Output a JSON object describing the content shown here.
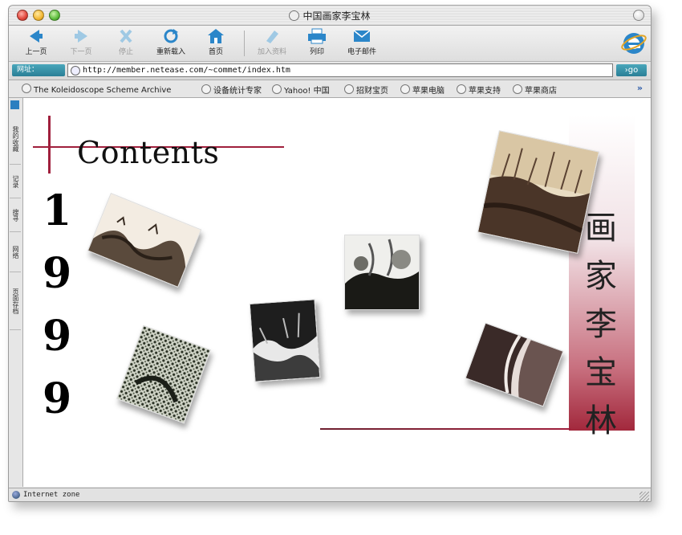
{
  "window": {
    "title": "中国画家李宝林"
  },
  "toolbar": {
    "back": "上一页",
    "forward": "下一页",
    "stop": "停止",
    "refresh": "重新载入",
    "home": "首页",
    "favorites": "加入资料",
    "print": "列印",
    "mail": "电子邮件"
  },
  "address": {
    "label": "网址：",
    "url": "http://member.netease.com/~commet/index.htm",
    "go": "go"
  },
  "favorites_bar": [
    "The Koleidoscope Scheme Archive",
    "设备统计专家",
    "Yahoo! 中国",
    "招财宝页",
    "苹果电脑",
    "苹果支持",
    "苹果商店"
  ],
  "side_tabs": [
    "我的收藏",
    "记录",
    "搜寻",
    "网络",
    "页面存档"
  ],
  "page": {
    "heading": "Contents",
    "year": [
      "1",
      "9",
      "9",
      "9"
    ],
    "artist_name": [
      "画",
      "家",
      "李",
      "宝",
      "林"
    ],
    "colors": {
      "accent": "#a01f3c"
    }
  },
  "status": {
    "zone": "Internet zone"
  }
}
